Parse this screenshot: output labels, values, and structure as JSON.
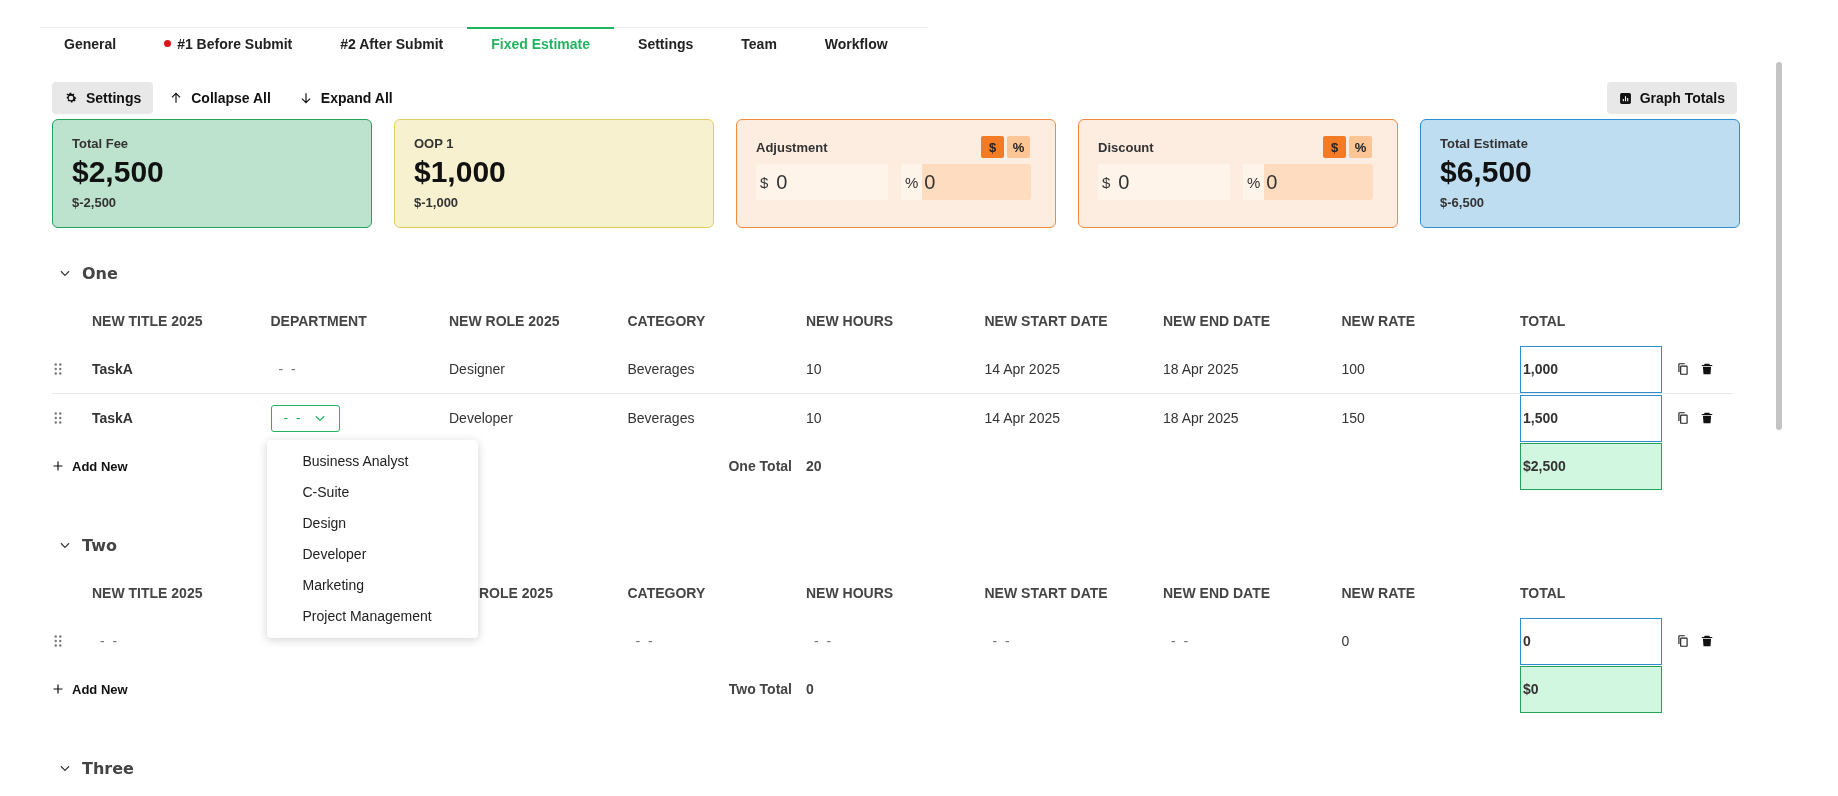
{
  "tabs": [
    {
      "label": "General",
      "selected": false,
      "alert": false
    },
    {
      "label": "#1 Before Submit",
      "selected": false,
      "alert": true
    },
    {
      "label": "#2 After Submit",
      "selected": false,
      "alert": false
    },
    {
      "label": "Fixed Estimate",
      "selected": true,
      "alert": false
    },
    {
      "label": "Settings",
      "selected": false,
      "alert": false
    },
    {
      "label": "Team",
      "selected": false,
      "alert": false
    },
    {
      "label": "Workflow",
      "selected": false,
      "alert": false
    }
  ],
  "toolbar": [
    {
      "kind": "settings",
      "label": "Settings"
    },
    {
      "kind": "collapse",
      "label": "Collapse All"
    },
    {
      "kind": "expand",
      "label": "Expand All"
    }
  ],
  "graph_button": {
    "label": "Graph Totals"
  },
  "cards": [
    {
      "kind": "total",
      "title": "Total Fee",
      "amount": "$2,500",
      "sub": "$-2,500",
      "color": "#22a35a"
    },
    {
      "kind": "total",
      "title": "OOP 1",
      "amount": "$1,000",
      "sub": "$-1,000",
      "color": "#e3cf5f"
    },
    {
      "kind": "adjust",
      "title": "Adjustment",
      "color": "#f08a3c",
      "modes": [
        {
          "label": "$",
          "selected": true
        },
        {
          "label": "%",
          "selected": false
        }
      ],
      "fields": [
        {
          "prefix": "$",
          "value": "0"
        },
        {
          "prefix": "%",
          "value": "0"
        }
      ]
    },
    {
      "kind": "adjust",
      "title": "Discount",
      "color": "#f08a3c",
      "modes": [
        {
          "label": "$",
          "selected": true
        },
        {
          "label": "%",
          "selected": false
        }
      ],
      "fields": [
        {
          "prefix": "$",
          "value": "0"
        },
        {
          "prefix": "%",
          "value": "0"
        }
      ]
    },
    {
      "kind": "total",
      "title": "Total Estimate",
      "amount": "$6,500",
      "sub": "$-6,500",
      "color": "#2b8fd1"
    }
  ],
  "sections": [
    {
      "title": "One",
      "expanded": true,
      "columns": [
        {
          "label": "NEW TITLE 2025",
          "covered": false
        },
        {
          "label": "DEPARTMENT",
          "covered": false
        },
        {
          "label": "NEW ROLE 2025",
          "covered": false
        },
        {
          "label": "CATEGORY",
          "covered": false
        },
        {
          "label": "NEW HOURS",
          "covered": false
        },
        {
          "label": "NEW START DATE",
          "covered": false
        },
        {
          "label": "NEW END DATE",
          "covered": false
        },
        {
          "label": "NEW RATE",
          "covered": false
        }
      ],
      "total_column": "TOTAL",
      "rows": [
        {
          "cells": [
            {
              "kind": "title",
              "value": "TaskA"
            },
            {
              "kind": "empty",
              "value": "- -"
            },
            {
              "kind": "text",
              "value": "Designer"
            },
            {
              "kind": "text",
              "value": "Beverages"
            },
            {
              "kind": "text",
              "value": "10"
            },
            {
              "kind": "text",
              "value": "14 Apr 2025"
            },
            {
              "kind": "text",
              "value": "18 Apr 2025"
            },
            {
              "kind": "text",
              "value": "100"
            }
          ],
          "total": "1,000"
        },
        {
          "cells": [
            {
              "kind": "title",
              "value": "TaskA"
            },
            {
              "kind": "select",
              "value": "- -",
              "open": true,
              "options": [
                "Business Analyst",
                "C-Suite",
                "Design",
                "Developer",
                "Marketing",
                "Project Management"
              ]
            },
            {
              "kind": "text",
              "value": "Developer"
            },
            {
              "kind": "text",
              "value": "Beverages"
            },
            {
              "kind": "text",
              "value": "10"
            },
            {
              "kind": "text",
              "value": "14 Apr 2025"
            },
            {
              "kind": "text",
              "value": "18 Apr 2025"
            },
            {
              "kind": "text",
              "value": "150"
            }
          ],
          "total": "1,500"
        }
      ],
      "add_label": "Add New",
      "total_label": "One Total",
      "total_hours": "20",
      "grand_total": "$2,500"
    },
    {
      "title": "Two",
      "expanded": true,
      "columns": [
        {
          "label": "NEW TITLE 2025",
          "covered": false
        },
        null,
        {
          "label": "ROLE 2025",
          "covered": false
        },
        {
          "label": "CATEGORY",
          "covered": false
        },
        {
          "label": "NEW HOURS",
          "covered": false
        },
        {
          "label": "NEW START DATE",
          "covered": false
        },
        {
          "label": "NEW END DATE",
          "covered": false
        },
        {
          "label": "NEW RATE",
          "covered": false
        }
      ],
      "total_column": "TOTAL",
      "rows": [
        {
          "cells": [
            {
              "kind": "empty",
              "value": "- -"
            },
            null,
            null,
            {
              "kind": "empty",
              "value": "- -"
            },
            {
              "kind": "empty",
              "value": "- -"
            },
            {
              "kind": "empty",
              "value": "- -"
            },
            {
              "kind": "empty",
              "value": "- -"
            },
            {
              "kind": "text",
              "value": "0"
            }
          ],
          "total": "0"
        }
      ],
      "add_label": "Add New",
      "total_label": "Two Total",
      "total_hours": "0",
      "grand_total": "$0"
    },
    {
      "title": "Three",
      "expanded": true
    }
  ]
}
